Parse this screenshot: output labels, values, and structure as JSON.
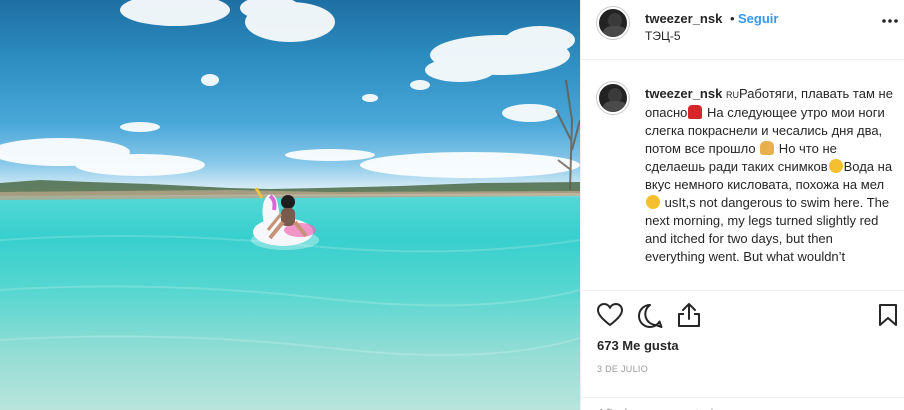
{
  "post": {
    "photo_alt": "",
    "header": {
      "username": "tweezer_nsk",
      "separator": "•",
      "follow_label": "Seguir",
      "location": "ТЭЦ-5",
      "more_icon": "more-horizontal-icon"
    },
    "caption": {
      "username": "tweezer_nsk",
      "lang_tag": "RU",
      "part1": "Работяги, плавать там не опасно",
      "part2": " На следующее утро мои ноги слегка покраснели и чесались дня два, потом все прошло ",
      "part3": " Но что не сделаешь ради таких снимков",
      "part4": "Вода на вкус немного кисловата, похожа на мел ",
      "part5": " usIt,s not dangerous to swim here. The next morning, my legs turned slightly red and itched for two days, but then everything went. But what wouldn’t"
    },
    "actions": {
      "like_icon": "heart-icon",
      "comment_icon": "comment-icon",
      "share_icon": "share-icon",
      "save_icon": "bookmark-icon"
    },
    "likes_text": "673 Me gusta",
    "date_text": "3 DE JULIO",
    "add_comment_placeholder": "Añade un comentario..."
  },
  "colors": {
    "accent": "#3897f0",
    "text": "#262626",
    "muted": "#999999",
    "divider": "#efefef"
  }
}
